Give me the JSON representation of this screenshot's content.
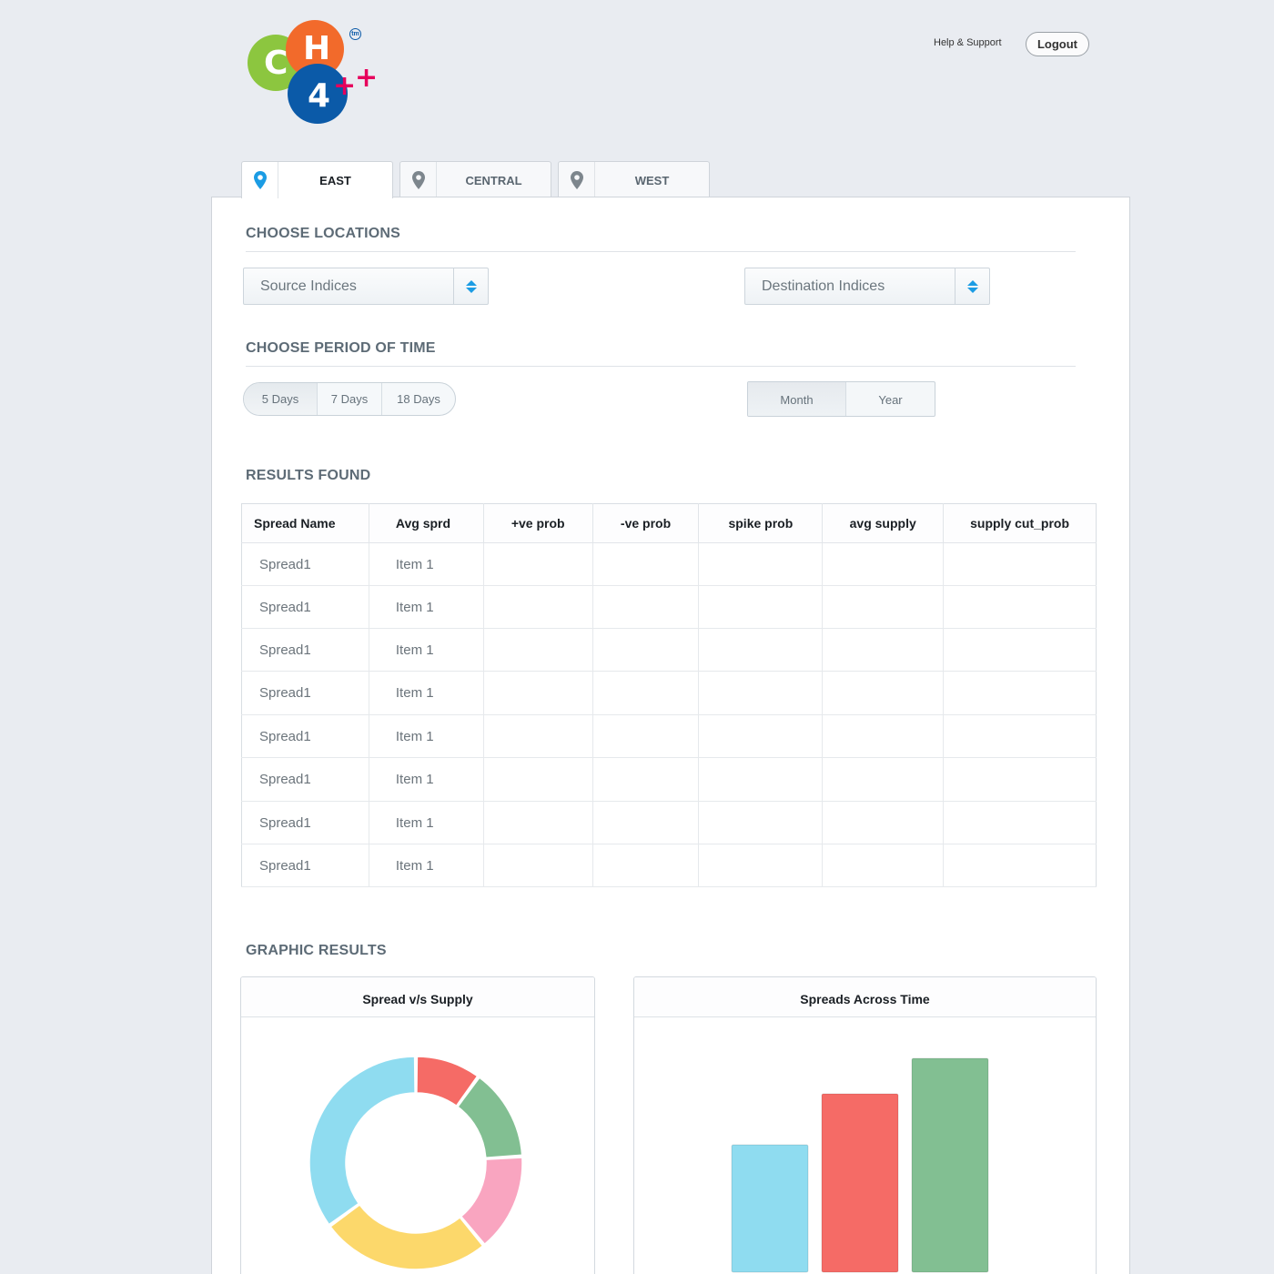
{
  "header": {
    "logo": {
      "letters": [
        "C",
        "H",
        "4"
      ],
      "trademark": "tm",
      "plus_marks": [
        "+",
        "+"
      ]
    },
    "help_label": "Help & Support",
    "logout_label": "Logout"
  },
  "tabs": [
    {
      "label": "EAST",
      "icon": "location-pin-icon",
      "active": true
    },
    {
      "label": "CENTRAL",
      "icon": "location-pin-icon",
      "active": false
    },
    {
      "label": "WEST",
      "icon": "location-pin-icon",
      "active": false
    }
  ],
  "locations": {
    "title": "CHOOSE LOCATIONS",
    "source_selected": "Source Indices",
    "destination_selected": "Destination Indices"
  },
  "period": {
    "title": "CHOOSE PERIOD OF TIME",
    "days_options": [
      "5 Days",
      "7 Days",
      "18 Days"
    ],
    "days_selected": "5 Days",
    "range_options": [
      "Month",
      "Year"
    ],
    "range_selected": "Month"
  },
  "results": {
    "title": "RESULTS FOUND",
    "columns": [
      "Spread Name",
      "Avg sprd",
      "+ve prob",
      "-ve prob",
      "spike prob",
      "avg supply",
      "supply cut_prob"
    ],
    "rows": [
      [
        "Spread1",
        "Item 1",
        "",
        "",
        "",
        "",
        ""
      ],
      [
        "Spread1",
        "Item 1",
        "",
        "",
        "",
        "",
        ""
      ],
      [
        "Spread1",
        "Item 1",
        "",
        "",
        "",
        "",
        ""
      ],
      [
        "Spread1",
        "Item 1",
        "",
        "",
        "",
        "",
        ""
      ],
      [
        "Spread1",
        "Item 1",
        "",
        "",
        "",
        "",
        ""
      ],
      [
        "Spread1",
        "Item 1",
        "",
        "",
        "",
        "",
        ""
      ],
      [
        "Spread1",
        "Item 1",
        "",
        "",
        "",
        "",
        ""
      ],
      [
        "Spread1",
        "Item 1",
        "",
        "",
        "",
        "",
        ""
      ]
    ]
  },
  "graphics": {
    "title": "GRAPHIC RESULTS",
    "donut_title": "Spread v/s Supply",
    "bar_title": "Spreads Across Time"
  },
  "colors": {
    "accent": "#1b9ce4",
    "pin_inactive": "#7d868d",
    "cyan": "#8fdcf0",
    "red": "#f56b66",
    "green": "#82bf92",
    "pink": "#f9a5c0",
    "yellow": "#fcd86b"
  },
  "chart_data": [
    {
      "type": "pie",
      "title": "Spread v/s Supply",
      "values": [
        10,
        14,
        15,
        26,
        35
      ],
      "slice_colors": [
        "#f56b66",
        "#82bf92",
        "#f9a5c0",
        "#fcd86b",
        "#8fdcf0"
      ]
    },
    {
      "type": "bar",
      "title": "Spreads Across Time",
      "values": [
        140,
        196,
        235
      ],
      "bar_colors": [
        "#8fdcf0",
        "#f56b66",
        "#82bf92"
      ]
    }
  ]
}
